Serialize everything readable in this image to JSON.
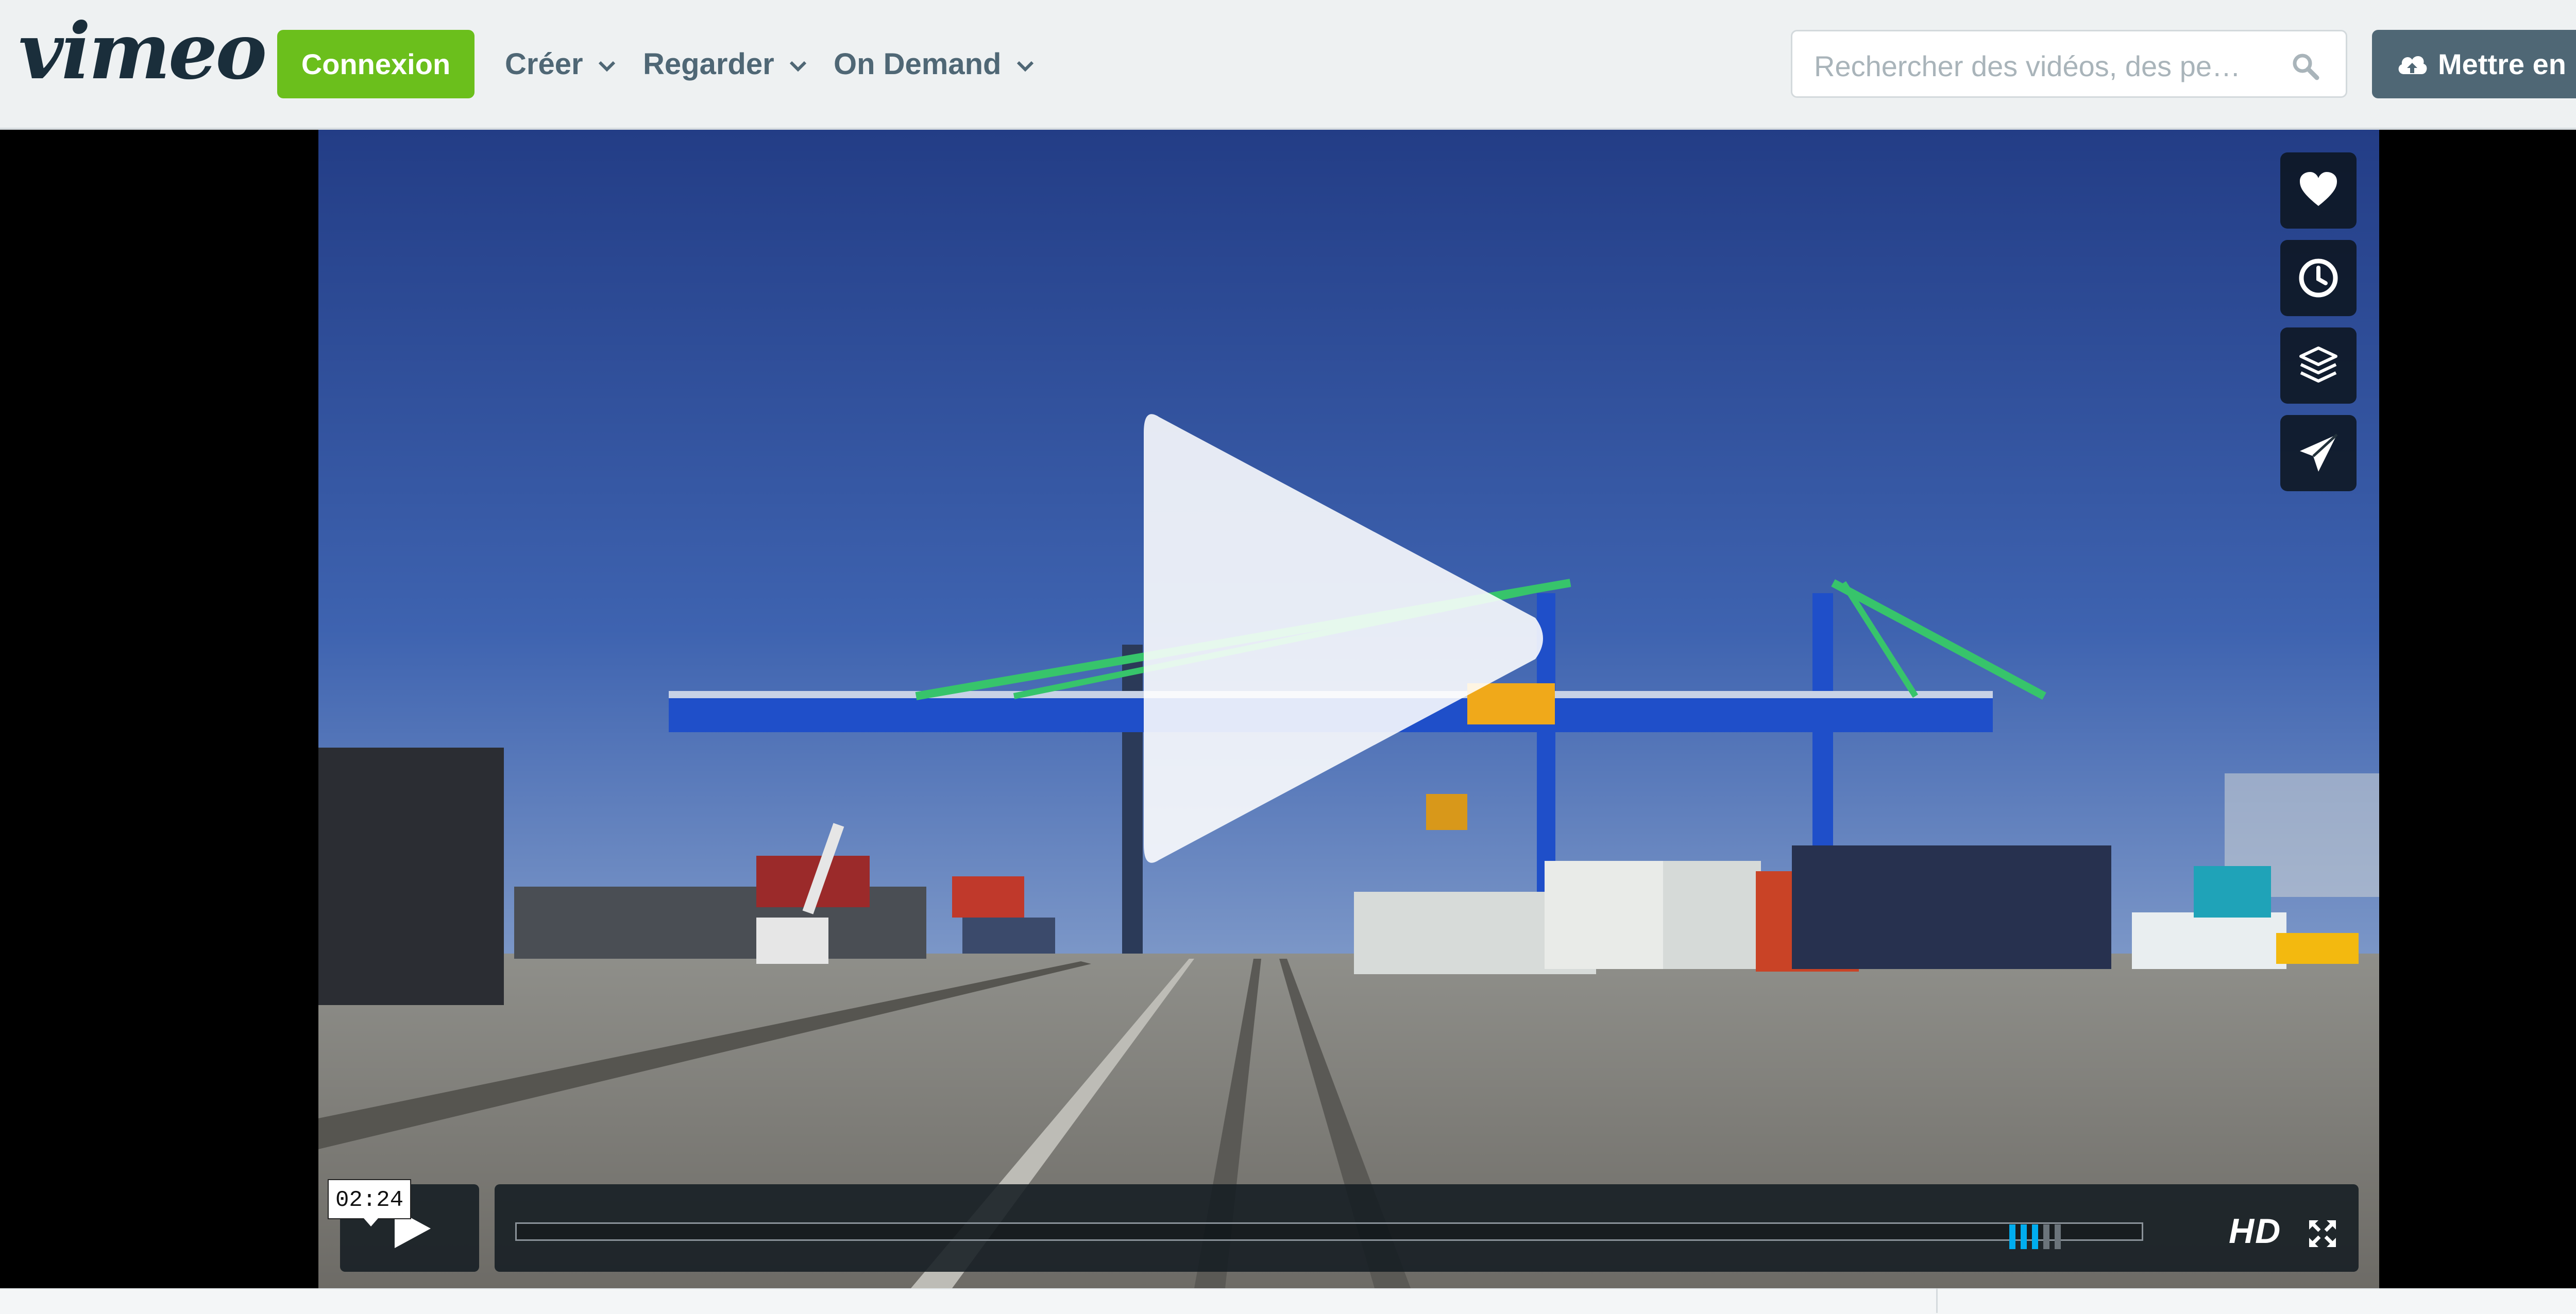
{
  "header": {
    "logo_text": "vimeo",
    "login_label": "Connexion",
    "nav": [
      {
        "label": "Créer"
      },
      {
        "label": "Regarder"
      },
      {
        "label": "On Demand"
      }
    ],
    "search": {
      "placeholder": "Rechercher des vidéos, des pe…",
      "value": ""
    },
    "upload_label": "Mettre en ligne"
  },
  "player": {
    "side_actions": [
      {
        "icon": "heart-icon"
      },
      {
        "icon": "clock-icon"
      },
      {
        "icon": "layers-icon"
      },
      {
        "icon": "paper-plane-icon"
      }
    ],
    "timecode": "02:24",
    "progress_fraction": 0.0,
    "volume_level_fraction": 0.6,
    "hd_label": "HD"
  },
  "colors": {
    "accent_green": "#6bbf1c",
    "header_bg": "#eef1f2",
    "nav_text": "#4f6775",
    "player_accent": "#00adef"
  }
}
